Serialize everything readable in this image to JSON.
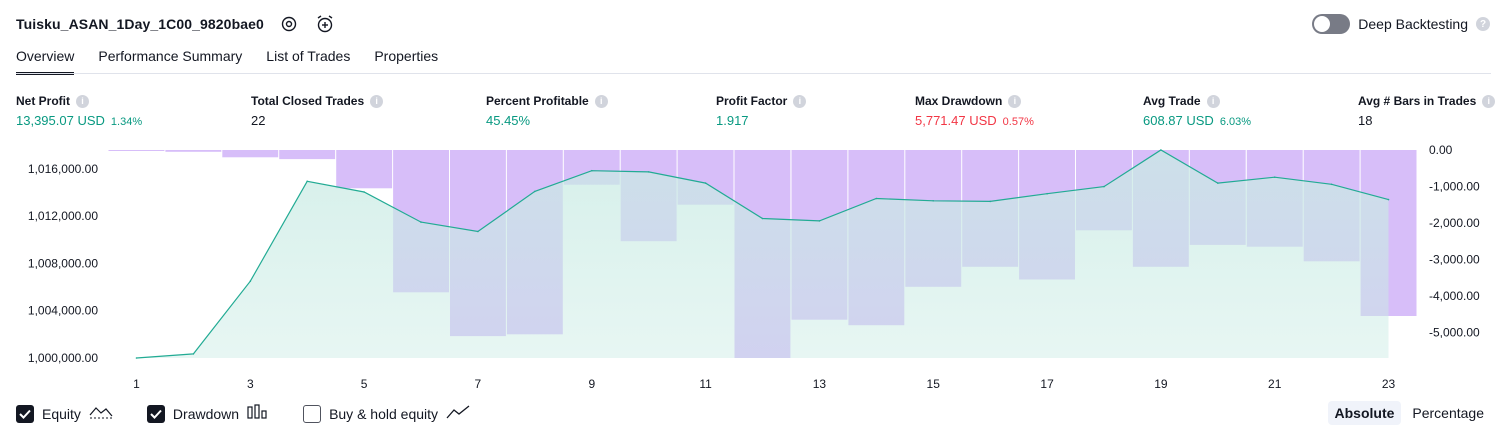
{
  "header": {
    "title": "Tuisku_ASAN_1Day_1C00_9820bae0",
    "settings_icon": "gear-icon",
    "alert_icon": "alarm-clock-add-icon"
  },
  "deep_backtesting": {
    "label": "Deep Backtesting",
    "enabled": false,
    "help_icon": "question-icon"
  },
  "tabs": [
    {
      "label": "Overview",
      "active": true
    },
    {
      "label": "Performance Summary",
      "active": false
    },
    {
      "label": "List of Trades",
      "active": false
    },
    {
      "label": "Properties",
      "active": false
    }
  ],
  "metrics": [
    {
      "label": "Net Profit",
      "value": "13,395.07 USD",
      "sub": "1.34%",
      "tone": "green"
    },
    {
      "label": "Total Closed Trades",
      "value": "22",
      "sub": "",
      "tone": "plain"
    },
    {
      "label": "Percent Profitable",
      "value": "45.45%",
      "sub": "",
      "tone": "green"
    },
    {
      "label": "Profit Factor",
      "value": "1.917",
      "sub": "",
      "tone": "green"
    },
    {
      "label": "Max Drawdown",
      "value": "5,771.47 USD",
      "sub": "0.57%",
      "tone": "red"
    },
    {
      "label": "Avg Trade",
      "value": "608.87 USD",
      "sub": "6.03%",
      "tone": "green"
    },
    {
      "label": "Avg # Bars in Trades",
      "value": "18",
      "sub": "",
      "tone": "plain"
    }
  ],
  "chart_data": {
    "type": "line",
    "x": [
      1,
      2,
      3,
      4,
      5,
      6,
      7,
      8,
      9,
      10,
      11,
      12,
      13,
      14,
      15,
      16,
      17,
      18,
      19,
      20,
      21,
      22,
      23
    ],
    "x_tick_labels": [
      "1",
      "3",
      "5",
      "7",
      "9",
      "11",
      "13",
      "15",
      "17",
      "19",
      "21",
      "23"
    ],
    "left_tick_labels": [
      "1,016,000.00",
      "1,012,000.00",
      "1,008,000.00",
      "1,004,000.00",
      "1,000,000.00"
    ],
    "right_tick_labels": [
      "0.00",
      "-1,000.00",
      "-2,000.00",
      "-3,000.00",
      "-4,000.00",
      "-5,000.00"
    ],
    "left_ylim": [
      1000000,
      1017600
    ],
    "right_ylim": [
      -5700,
      0
    ],
    "series": [
      {
        "name": "Equity",
        "axis": "left",
        "values": [
          1000000,
          1000350,
          1006500,
          1014950,
          1014050,
          1011500,
          1010700,
          1014100,
          1015850,
          1015750,
          1014800,
          1011800,
          1011600,
          1013500,
          1013300,
          1013250,
          1013900,
          1014500,
          1017600,
          1014800,
          1015300,
          1014700,
          1013400
        ]
      },
      {
        "name": "Drawdown",
        "axis": "right",
        "values": [
          -10,
          -50,
          -200,
          -250,
          -1050,
          -3900,
          -5100,
          -5050,
          -950,
          -2500,
          -1500,
          -5700,
          -4650,
          -4800,
          -3750,
          -3200,
          -3550,
          -2200,
          -3200,
          -2600,
          -2650,
          -3050,
          -4550
        ]
      }
    ],
    "colors": {
      "equity_line": "#22ab94",
      "equity_fill": "#c9ebe4",
      "drawdown_fill": "#c9a8f7",
      "axis_text": "#131722"
    }
  },
  "legend": [
    {
      "label": "Equity",
      "checked": true,
      "icon": "equity-line-icon"
    },
    {
      "label": "Drawdown",
      "checked": true,
      "icon": "drawdown-bars-icon"
    },
    {
      "label": "Buy & hold equity",
      "checked": false,
      "icon": "buy-hold-line-icon"
    }
  ],
  "scale_toggle": {
    "options": [
      "Absolute",
      "Percentage"
    ],
    "selected": "Absolute"
  }
}
